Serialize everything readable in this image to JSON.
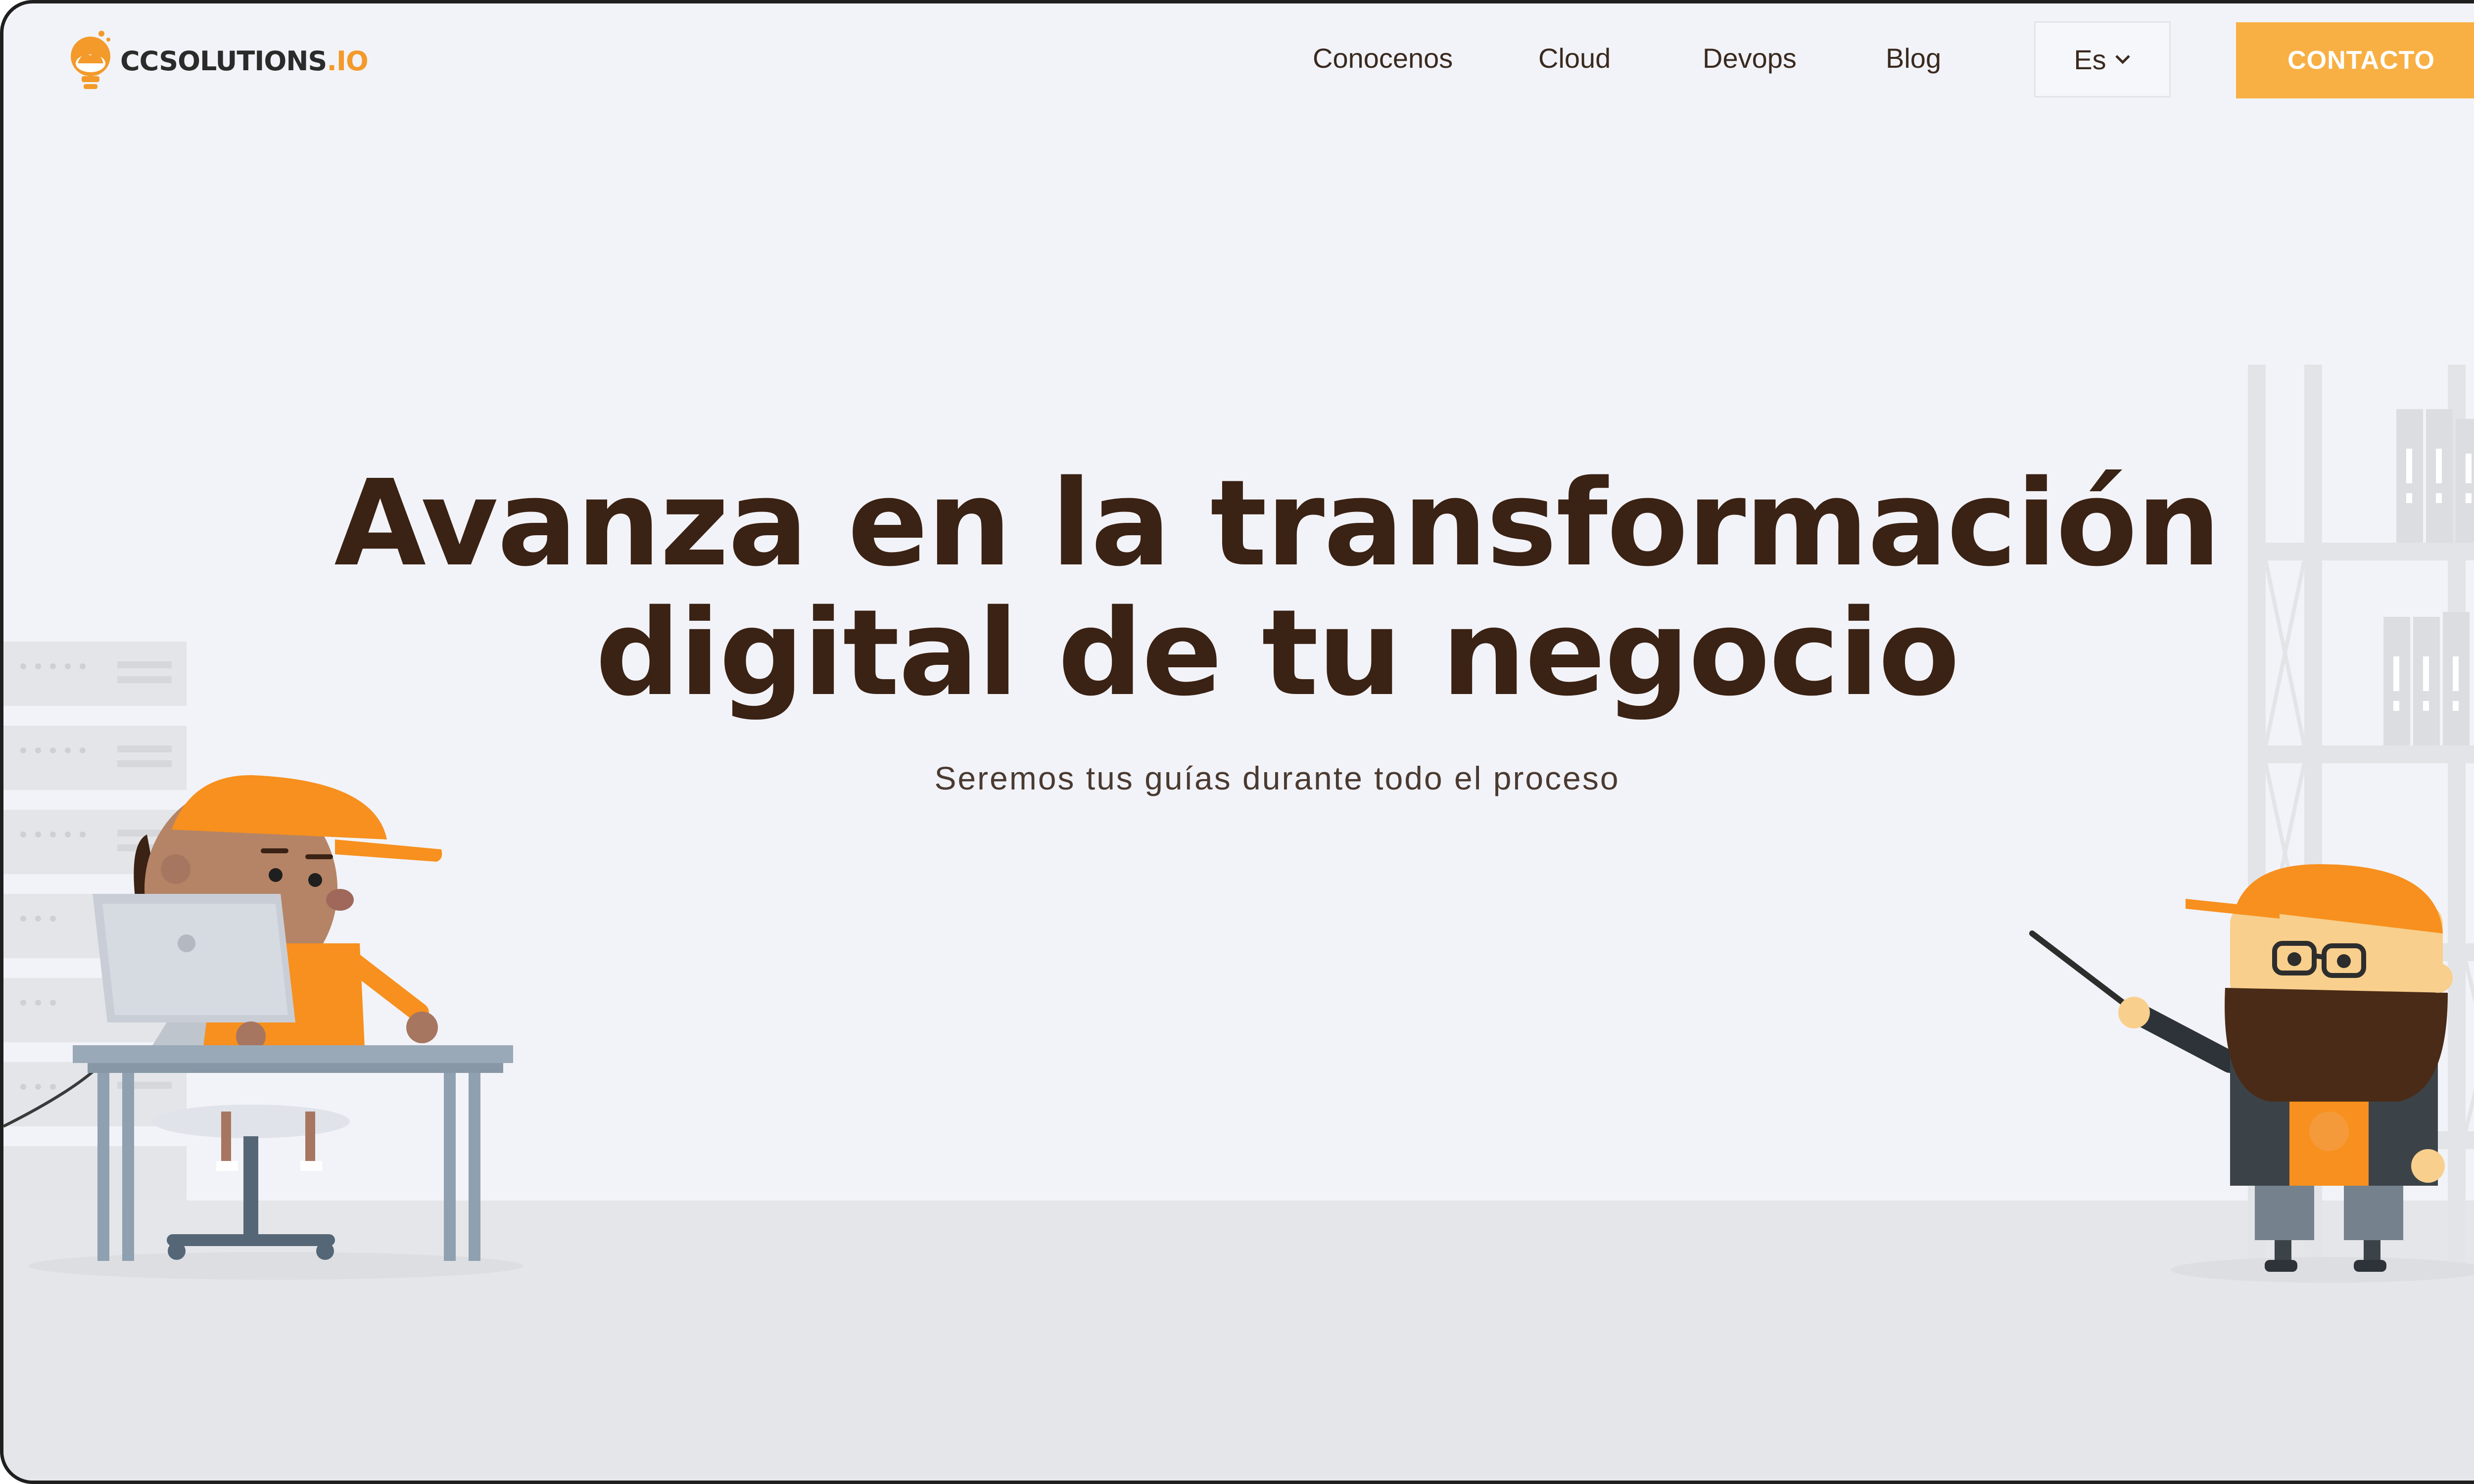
{
  "brand": {
    "logo_main": "CCSOLUTIONS",
    "logo_tld": ".IO"
  },
  "nav": {
    "items": [
      {
        "label": "Conocenos"
      },
      {
        "label": "Cloud"
      },
      {
        "label": "Devops"
      },
      {
        "label": "Blog"
      }
    ],
    "language": "Es",
    "cta": "CONTACTO"
  },
  "hero": {
    "title_line1": "Avanza en la transformación",
    "title_line2": "digital de tu negocio",
    "subtitle": "Seremos tus guías durante todo el proceso"
  },
  "colors": {
    "accent": "#f8b044",
    "heading": "#3a2214",
    "background": "#f2f3f8",
    "floor": "#e5e6e9"
  },
  "icons": [
    "lightbulb-logo-icon",
    "chevron-down-icon"
  ]
}
